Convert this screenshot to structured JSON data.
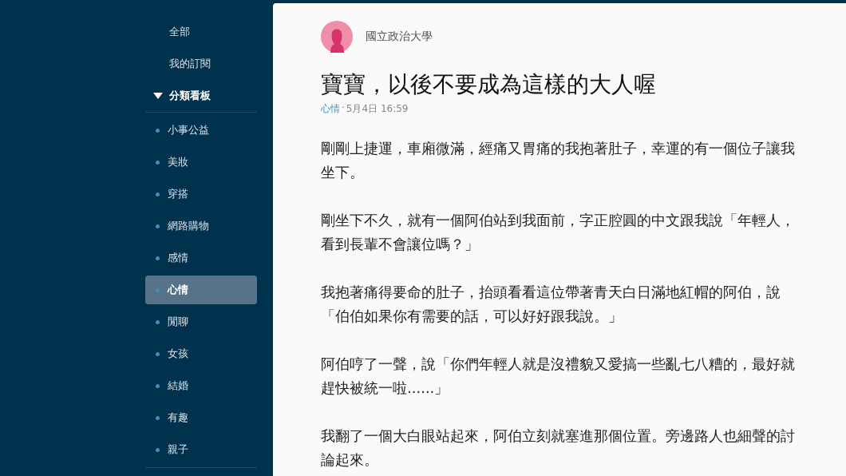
{
  "sidebar": {
    "items": [
      {
        "label": "全部",
        "selected": false
      },
      {
        "label": "我的訂閱",
        "selected": false
      }
    ],
    "section": {
      "label": "分類看板",
      "expanded": true,
      "children": [
        {
          "label": "小事公益",
          "selected": false
        },
        {
          "label": "美妝",
          "selected": false
        },
        {
          "label": "穿搭",
          "selected": false
        },
        {
          "label": "網路購物",
          "selected": false
        },
        {
          "label": "感情",
          "selected": false
        },
        {
          "label": "心情",
          "selected": true
        },
        {
          "label": "閒聊",
          "selected": false
        },
        {
          "label": "女孩",
          "selected": false
        },
        {
          "label": "結婚",
          "selected": false
        },
        {
          "label": "有趣",
          "selected": false
        },
        {
          "label": "親子",
          "selected": false
        }
      ]
    }
  },
  "post": {
    "author": "國立政治大學",
    "title": "寶寶，以後不要成為這樣的大人喔",
    "board": "心情",
    "separator": "·",
    "date": "5月4日 16:59",
    "paragraphs": [
      "剛剛上捷運，車廂微滿，經痛又胃痛的我抱著肚子，幸運的有一個位子讓我坐下。",
      "剛坐下不久，就有一個阿伯站到我面前，字正腔圓的中文跟我說「年輕人，看到長輩不會讓位嗎？」",
      "我抱著痛得要命的肚子，抬頭看看這位帶著青天白日滿地紅帽的阿伯，說「伯伯如果你有需要的話，可以好好跟我說。」",
      "阿伯哼了一聲，說「你們年輕人就是沒禮貌又愛搞一些亂七八糟的，最好就趕快被統一啦......」",
      "我翻了一個大白眼站起來，阿伯立刻就塞進那個位置。旁邊路人也細聲的討論起來。"
    ]
  }
}
